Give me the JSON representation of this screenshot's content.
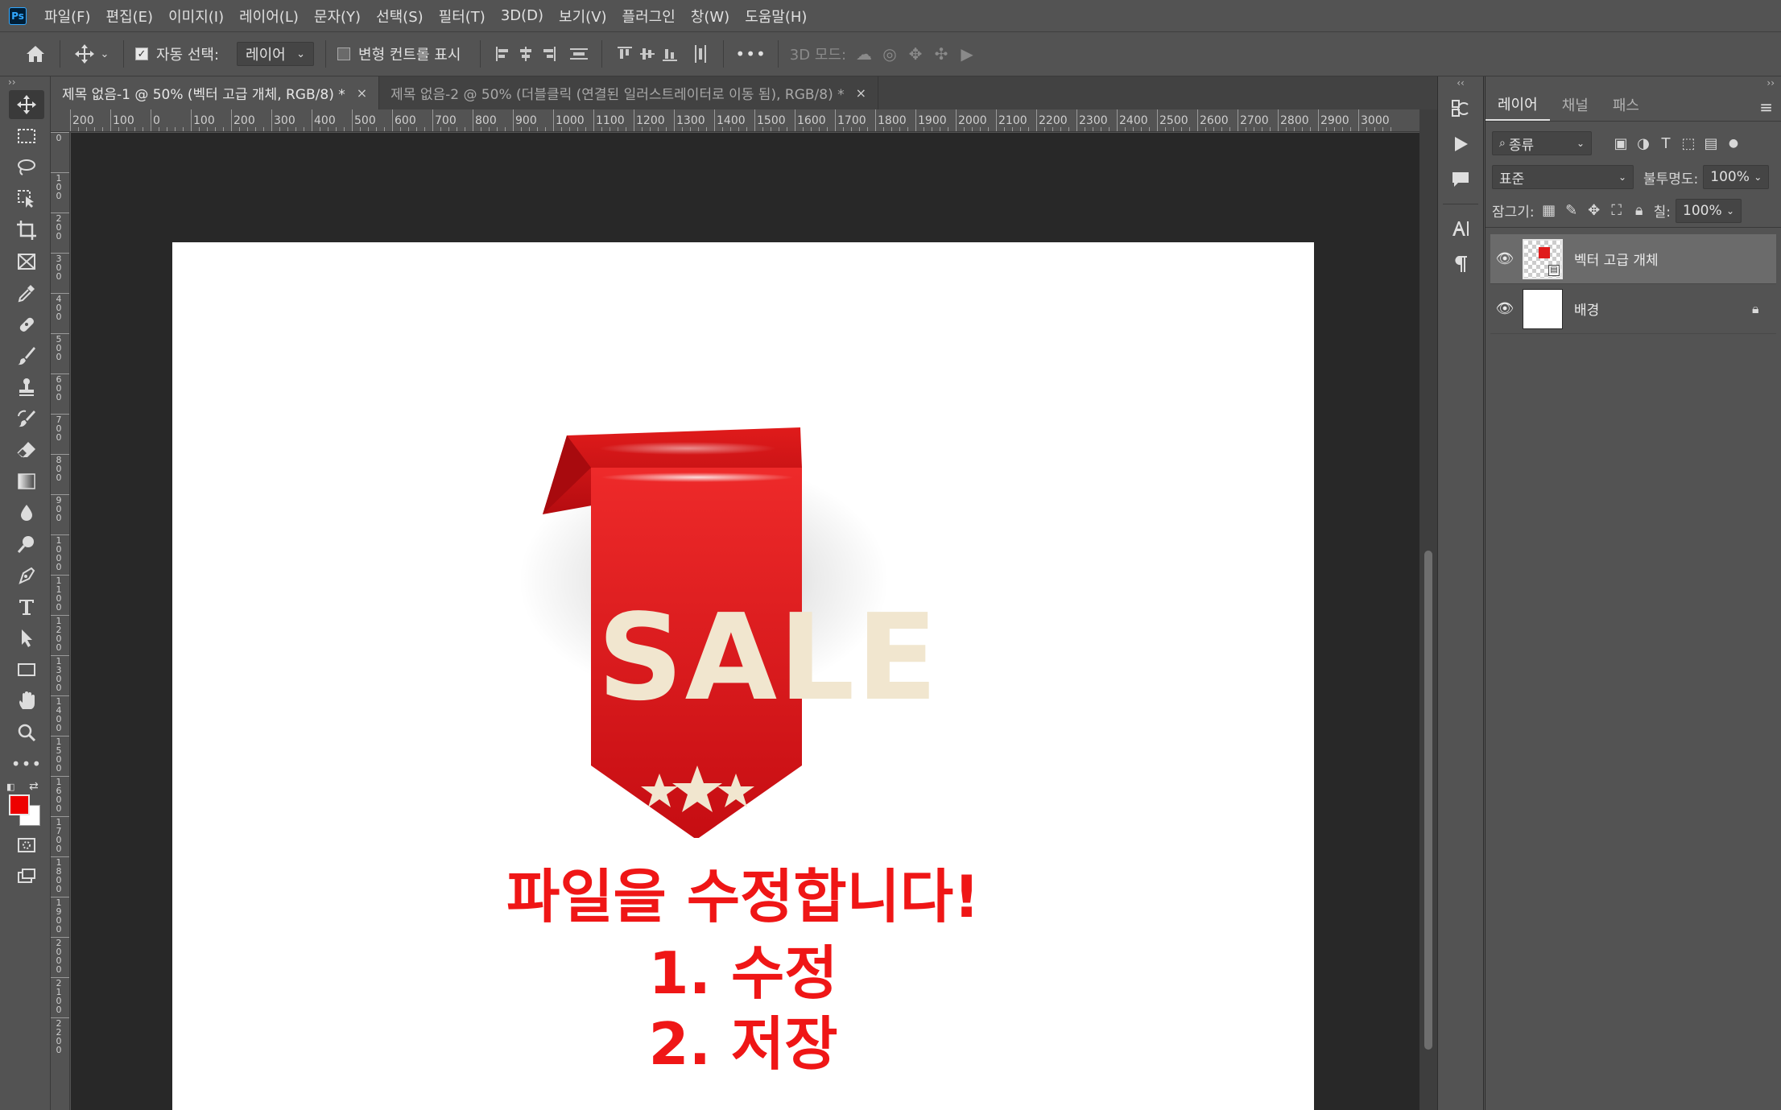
{
  "app": {
    "logo": "Ps"
  },
  "menu": [
    "파일(F)",
    "편집(E)",
    "이미지(I)",
    "레이어(L)",
    "문자(Y)",
    "선택(S)",
    "필터(T)",
    "3D(D)",
    "보기(V)",
    "플러그인",
    "창(W)",
    "도움말(H)"
  ],
  "options": {
    "auto_select_label": "자동 선택:",
    "auto_select_checked": true,
    "auto_select_target": "레이어",
    "transform_controls_label": "변형 컨트롤 표시",
    "more_label": "•••",
    "mode_3d_label": "3D 모드:"
  },
  "tabs": [
    {
      "label": "제목 없음-1 @ 50% (벡터 고급 개체, RGB/8) *",
      "close": "×",
      "active": true
    },
    {
      "label": "제목 없음-2 @ 50% (더블클릭 (연결된 일러스트레이터로 이동 됨), RGB/8) *",
      "close": "×",
      "active": false
    }
  ],
  "ruler_top": [
    "200",
    "100",
    "0",
    "100",
    "200",
    "300",
    "400",
    "500",
    "600",
    "700",
    "800",
    "900",
    "1000",
    "1100",
    "1200",
    "1300",
    "1400",
    "1500",
    "1600",
    "1700",
    "1800",
    "1900",
    "2000",
    "2100",
    "2200",
    "2300",
    "2400",
    "2500",
    "2600",
    "2700",
    "2800",
    "2900",
    "3000"
  ],
  "ruler_left": [
    "0",
    "1\n0\n0",
    "2\n0\n0",
    "3\n0\n0",
    "4\n0\n0",
    "5\n0\n0",
    "6\n0\n0",
    "7\n0\n0",
    "8\n0\n0",
    "9\n0\n0",
    "1\n0\n0\n0",
    "1\n1\n0\n0",
    "1\n2\n0\n0",
    "1\n3\n0\n0",
    "1\n4\n0\n0",
    "1\n5\n0\n0",
    "1\n6\n0\n0",
    "1\n7\n0\n0",
    "1\n8\n0\n0",
    "1\n9\n0\n0",
    "2\n0\n0\n0",
    "2\n1\n0\n0",
    "2\n2\n0\n0"
  ],
  "artwork": {
    "badge_text": "SALE",
    "badge_color": "#e01b1b",
    "text_color": "#ef1616",
    "line1": "파일을 수정합니다!",
    "line2": "1. 수정",
    "line3": "2. 저장"
  },
  "colors": {
    "foreground": "#ee0000",
    "background": "#ffffff"
  },
  "layers_panel": {
    "tabs": [
      "레이어",
      "채널",
      "패스"
    ],
    "filter_kind": "종류",
    "blend_mode": "표준",
    "opacity_label": "불투명도:",
    "opacity_value": "100%",
    "lock_label": "잠그기:",
    "fill_label": "칠:",
    "fill_value": "100%",
    "layers": [
      {
        "name": "벡터 고급 개체",
        "selected": true,
        "locked": false
      },
      {
        "name": "배경",
        "selected": false,
        "locked": true
      }
    ]
  }
}
